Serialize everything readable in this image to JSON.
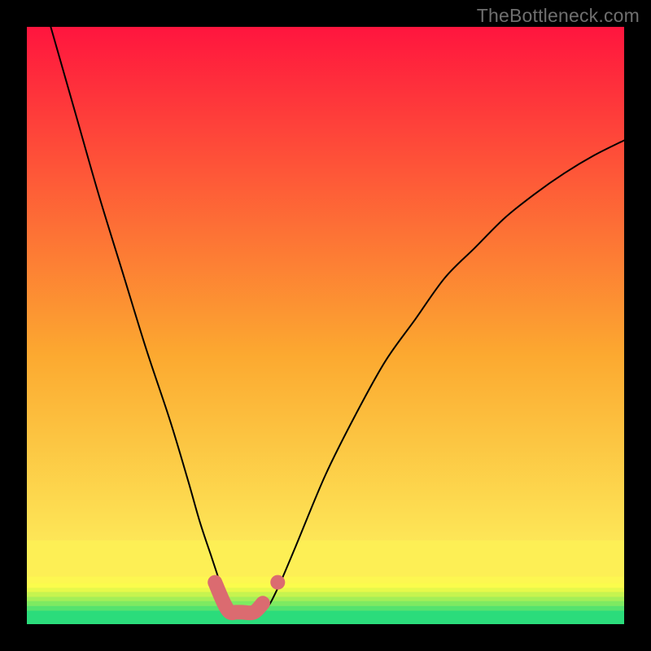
{
  "watermark": "TheBottleneck.com",
  "chart_data": {
    "type": "line",
    "title": "",
    "xlabel": "",
    "ylabel": "",
    "xlim": [
      0,
      100
    ],
    "ylim": [
      0,
      100
    ],
    "grid": false,
    "series": [
      {
        "name": "bottleneck-curve",
        "x": [
          4,
          8,
          12,
          16,
          20,
          24,
          27,
          29,
          31,
          33,
          34,
          35,
          36,
          38,
          40,
          42,
          45,
          50,
          55,
          60,
          65,
          70,
          75,
          80,
          85,
          90,
          95,
          100
        ],
        "y": [
          100,
          86,
          72,
          59,
          46,
          34,
          24,
          17,
          11,
          5,
          2.5,
          2,
          2,
          2,
          2.5,
          6,
          13,
          25,
          35,
          44,
          51,
          58,
          63,
          68,
          72,
          75.5,
          78.5,
          81
        ]
      }
    ],
    "highlight_segment": {
      "name": "highlight-band",
      "x": [
        31.5,
        33,
        34,
        35,
        36,
        38,
        39.5
      ],
      "y": [
        7,
        3.5,
        2,
        2,
        2,
        2,
        3.5
      ]
    },
    "highlight_point": {
      "x": 42,
      "y": 7
    },
    "background_bands": [
      {
        "from": 0,
        "to": 2.3,
        "color": "#2bdc7b"
      },
      {
        "from": 2.3,
        "to": 3.1,
        "color": "#55e36e"
      },
      {
        "from": 3.1,
        "to": 3.9,
        "color": "#7eea61"
      },
      {
        "from": 3.9,
        "to": 4.6,
        "color": "#a3ef57"
      },
      {
        "from": 4.6,
        "to": 5.4,
        "color": "#c6f44f"
      },
      {
        "from": 5.4,
        "to": 6.1,
        "color": "#e6f94a"
      },
      {
        "from": 6.1,
        "to": 6.9,
        "color": "#fbfc4c"
      },
      {
        "from": 6.9,
        "to": 8.0,
        "color": "#fdf751"
      },
      {
        "from": 8.0,
        "to": 14,
        "color": "#fdef55"
      }
    ],
    "gradient_top_color": "#ff153e",
    "gradient_mid_color": "#fca930",
    "gradient_low_color": "#fde657"
  }
}
